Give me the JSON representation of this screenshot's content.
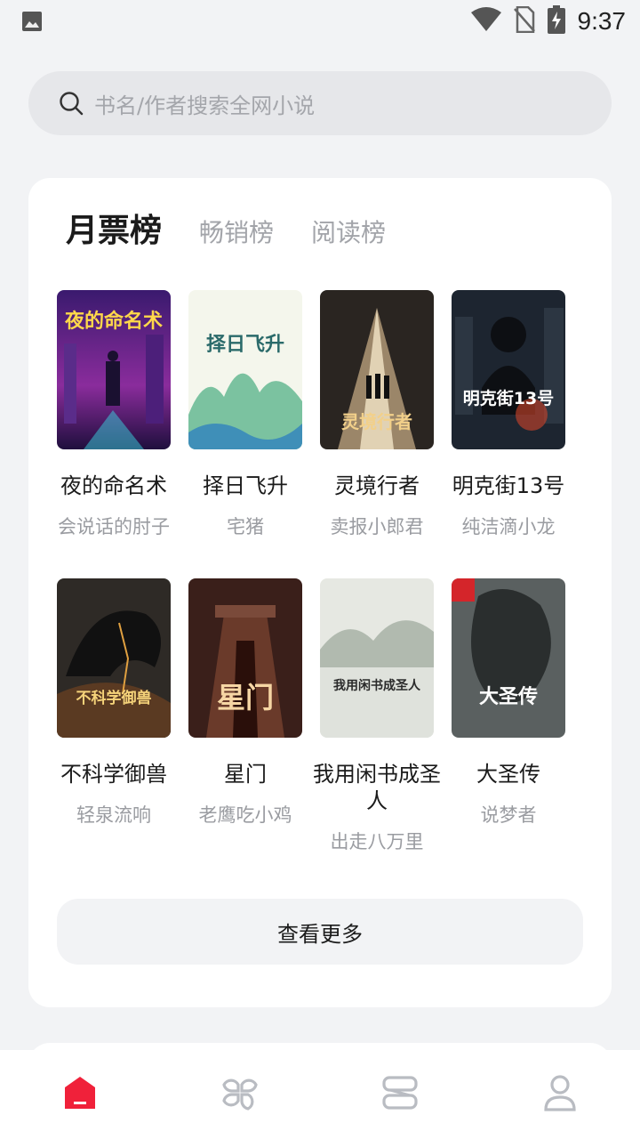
{
  "status_bar": {
    "time": "9:37",
    "icons": [
      "image-icon",
      "wifi-icon",
      "no-sim-icon",
      "battery-charging-icon"
    ]
  },
  "search": {
    "placeholder": "书名/作者搜索全网小说",
    "icon": "search-icon"
  },
  "rank": {
    "tabs": [
      {
        "label": "月票榜",
        "active": true
      },
      {
        "label": "畅销榜",
        "active": false
      },
      {
        "label": "阅读榜",
        "active": false
      }
    ],
    "books": [
      {
        "title": "夜的命名术",
        "author": "会说话的肘子",
        "cover_text": "夜的命名术"
      },
      {
        "title": "择日飞升",
        "author": "宅猪",
        "cover_text": "择日飞升"
      },
      {
        "title": "灵境行者",
        "author": "卖报小郎君",
        "cover_text": "灵境行者"
      },
      {
        "title": "明克街13号",
        "author": "纯洁滴小龙",
        "cover_text": "明克街13号"
      },
      {
        "title": "不科学御兽",
        "author": "轻泉流响",
        "cover_text": "不科学御兽"
      },
      {
        "title": "星门",
        "author": "老鹰吃小鸡",
        "cover_text": "星门"
      },
      {
        "title": "我用闲书成圣人",
        "author": "出走八万里",
        "cover_text": "我用闲书成圣人"
      },
      {
        "title": "大圣传",
        "author": "说梦者",
        "cover_text": "大圣传"
      }
    ],
    "more_label": "查看更多"
  },
  "bottom_nav": {
    "items": [
      {
        "icon": "home-icon",
        "active": true,
        "color": "#f0213a"
      },
      {
        "icon": "category-icon",
        "active": false,
        "color": "#b9bcc2"
      },
      {
        "icon": "bookshelf-icon",
        "active": false,
        "color": "#b9bcc2"
      },
      {
        "icon": "profile-icon",
        "active": false,
        "color": "#b9bcc2"
      }
    ]
  },
  "colors": {
    "accent": "#f0213a",
    "background": "#f2f3f5"
  }
}
